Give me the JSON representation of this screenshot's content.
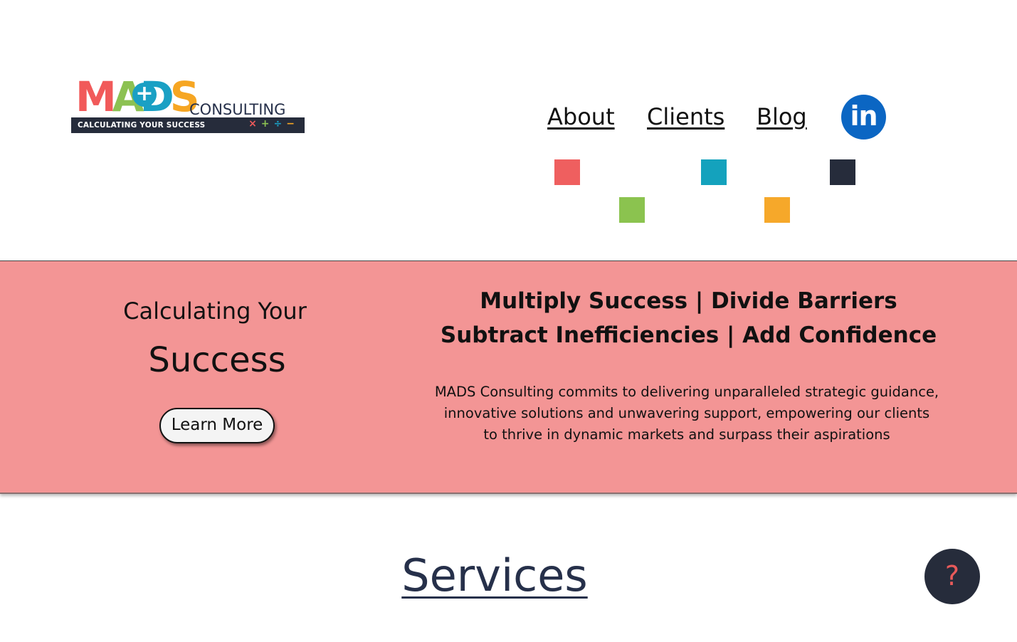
{
  "logo": {
    "letters": [
      {
        "char": "M",
        "color": "#f15a5a"
      },
      {
        "char": "A",
        "color": "#8cc152"
      },
      {
        "char": "D",
        "color": "#1aa0c4"
      },
      {
        "char": "S",
        "color": "#f6a623"
      }
    ],
    "plus": "+",
    "consulting": "CONSULTING",
    "tagline": "CALCULATING YOUR SUCCESS",
    "ops": [
      {
        "char": "×",
        "color": "#f15a5a"
      },
      {
        "char": "+",
        "color": "#8cc152"
      },
      {
        "char": "÷",
        "color": "#1aa0c4"
      },
      {
        "char": "−",
        "color": "#f6a623"
      }
    ]
  },
  "nav": {
    "about": "About",
    "clients": "Clients",
    "blog": "Blog",
    "linkedin_icon": "linkedin-icon",
    "linkedin_text": "in"
  },
  "colors": {
    "red": "#ef5f5f",
    "teal": "#14a2bd",
    "navy": "#262c3b",
    "green": "#8bc34f",
    "orange": "#f6a82a",
    "hero_bg": "#f39595"
  },
  "hero": {
    "subtitle": "Calculating Your",
    "title": "Success",
    "button": "Learn More",
    "headline_1": "Multiply Success | Divide Barriers",
    "headline_2": "Subtract Inefficiencies | Add Confidence",
    "desc_1": "MADS Consulting commits to delivering unparalleled strategic guidance,",
    "desc_2": "innovative solutions and unwavering support, empowering our clients",
    "desc_3": "to thrive in dynamic markets and surpass their aspirations"
  },
  "services": {
    "heading": "Services"
  },
  "help": {
    "icon": "question-mark-icon",
    "glyph": "?"
  }
}
